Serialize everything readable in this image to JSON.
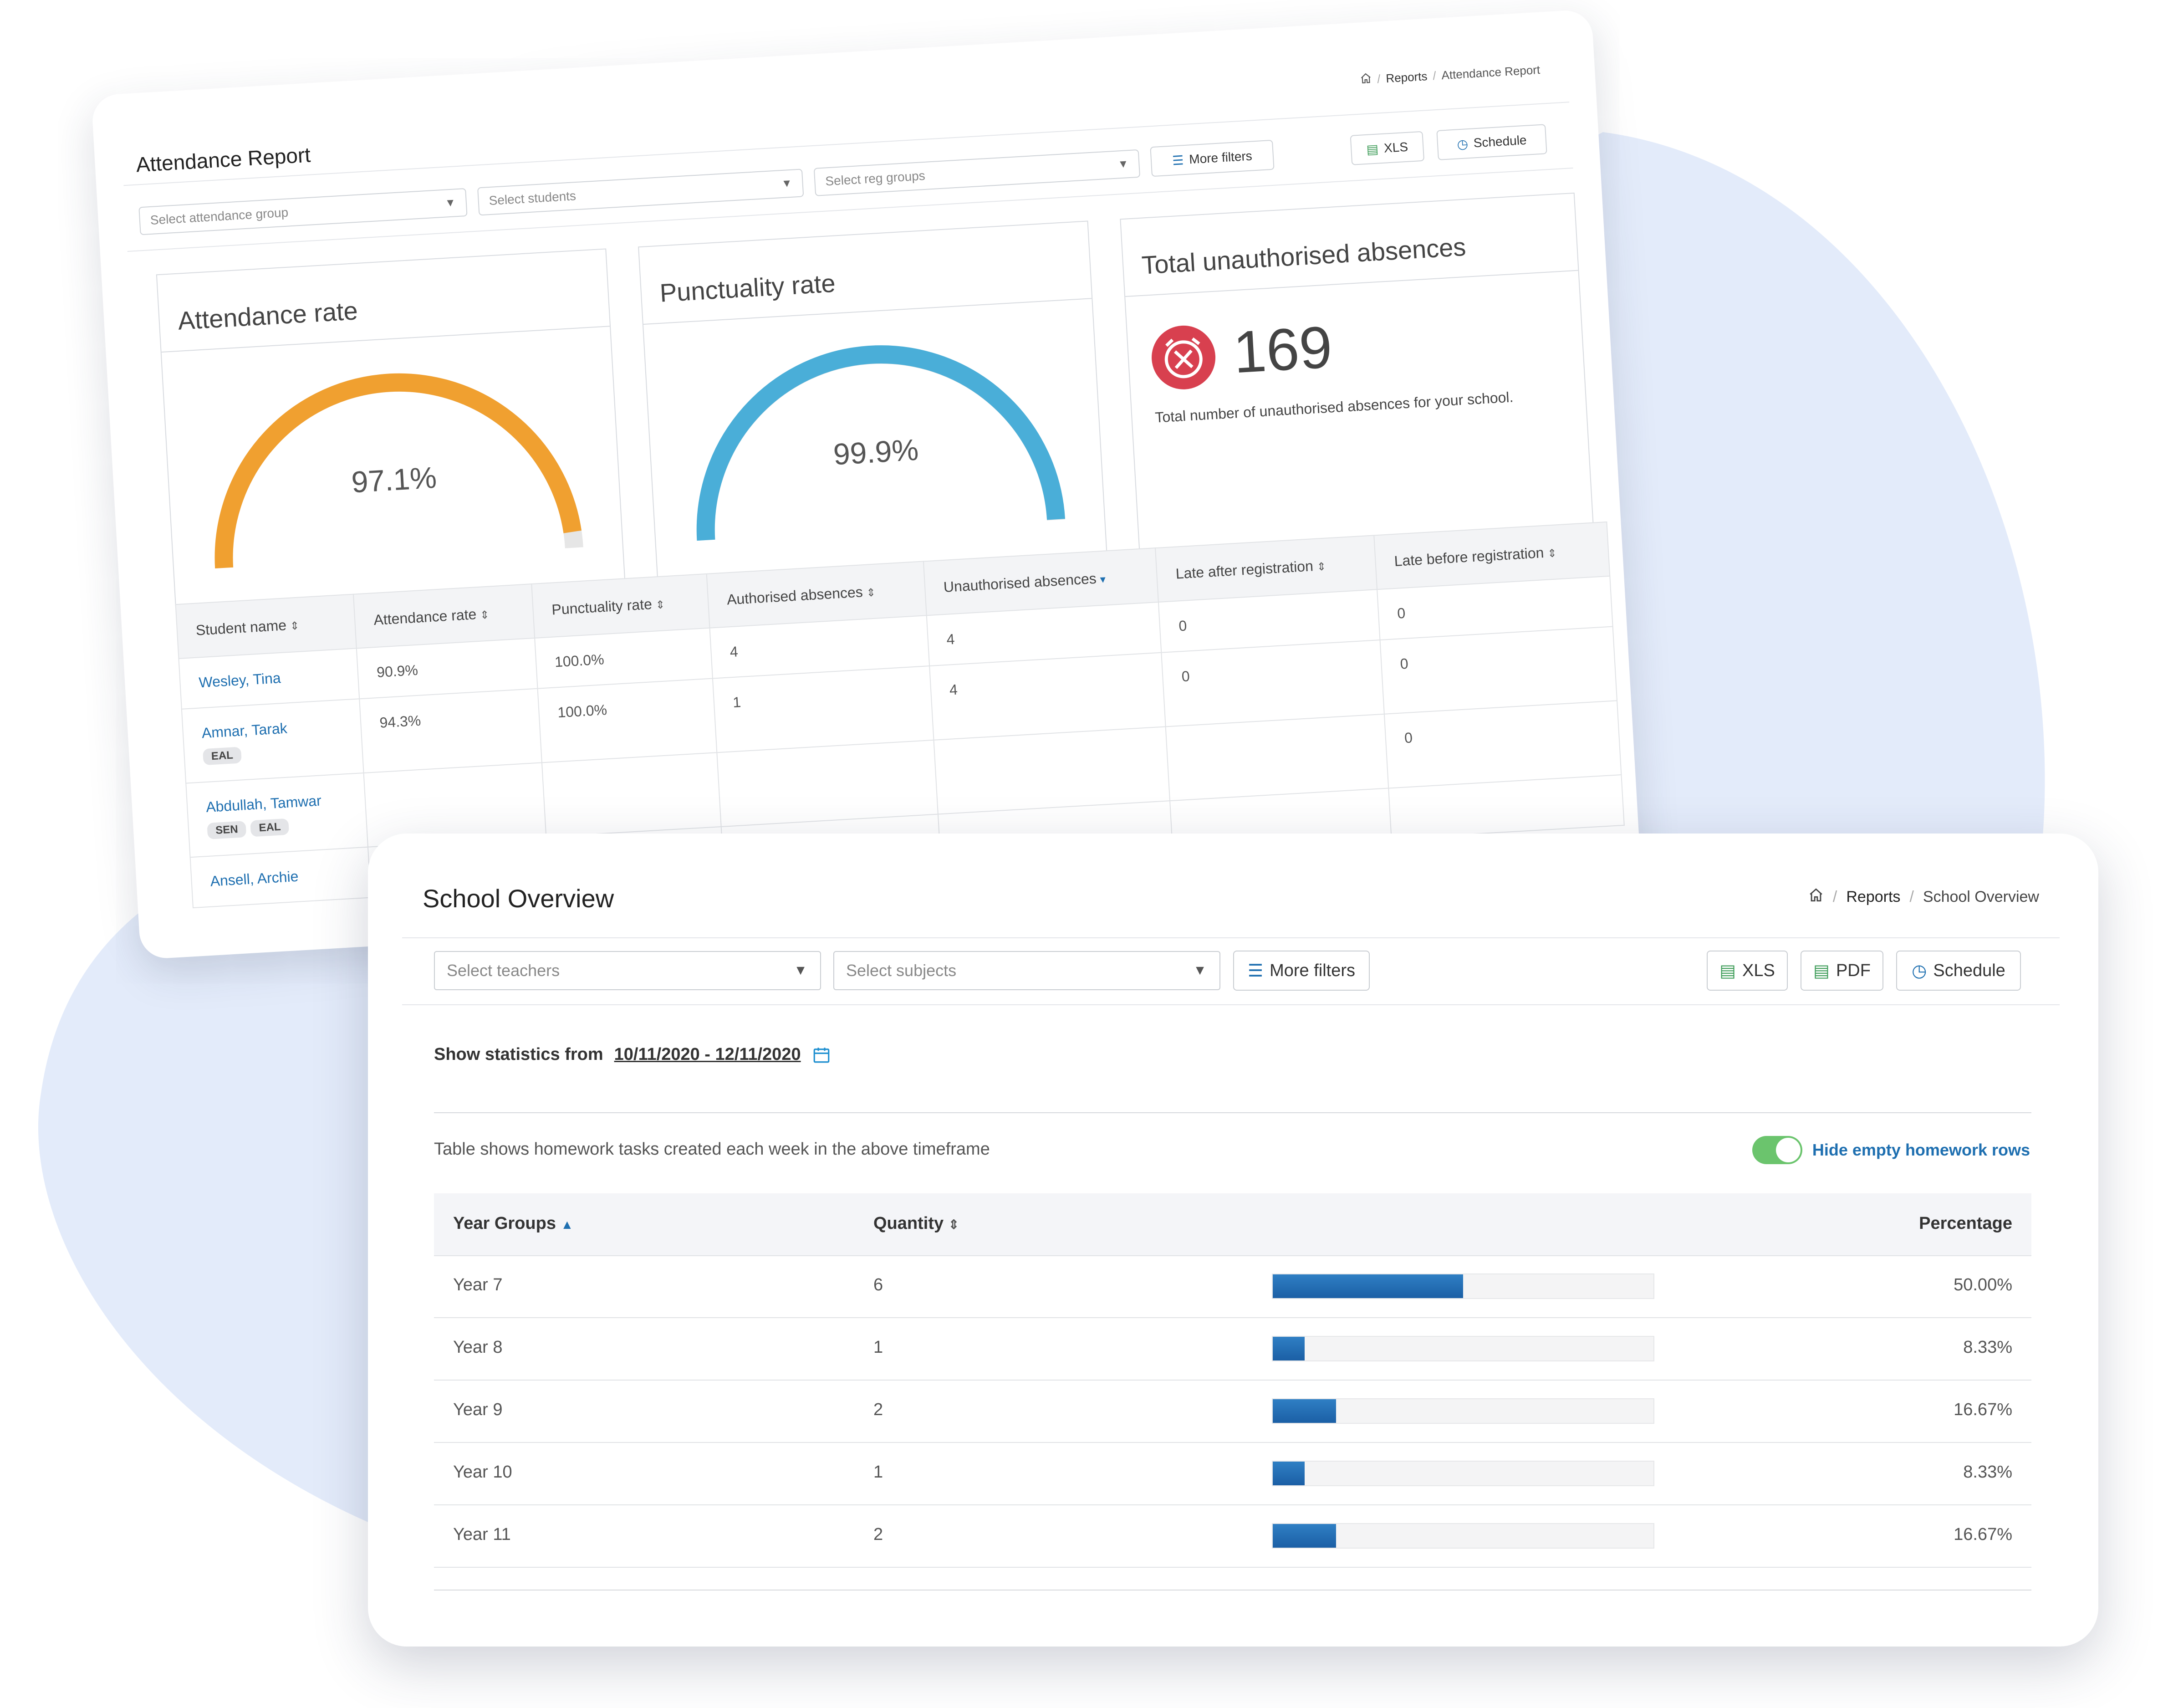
{
  "colors": {
    "accent_blue": "#1e6fb0",
    "gauge_orange": "#f0a030",
    "gauge_blue": "#4aaed8",
    "alarm_red": "#d8404f",
    "toggle_green": "#6bc46d",
    "blob": "#e3ebfa"
  },
  "attendance": {
    "title": "Attendance Report",
    "breadcrumb": {
      "home_icon": "home-icon",
      "reports": "Reports",
      "current": "Attendance Report"
    },
    "filters": {
      "group": "Select attendance group",
      "students": "Select students",
      "reg": "Select reg groups"
    },
    "buttons": {
      "more_filters": "More filters",
      "xls": "XLS",
      "schedule": "Schedule"
    },
    "cards": {
      "attendance_rate": {
        "title": "Attendance rate",
        "value": "97.1%",
        "percent": 97.1
      },
      "punctuality_rate": {
        "title": "Punctuality rate",
        "value": "99.9%",
        "percent": 99.9
      },
      "unauthorised": {
        "title": "Total unauthorised absences",
        "value": "169",
        "caption": "Total number of unauthorised absences for your school."
      }
    },
    "table": {
      "headers": [
        "Student name",
        "Attendance rate",
        "Punctuality rate",
        "Authorised absences",
        "Unauthorised absences",
        "Late after registration",
        "Late before registration"
      ],
      "rows": [
        {
          "name": "Wesley, Tina",
          "tags": [],
          "cells": [
            "90.9%",
            "100.0%",
            "4",
            "4",
            "0",
            "0"
          ]
        },
        {
          "name": "Amnar, Tarak",
          "tags": [
            "EAL"
          ],
          "cells": [
            "94.3%",
            "100.0%",
            "1",
            "4",
            "0",
            "0"
          ]
        },
        {
          "name": "Abdullah, Tamwar",
          "tags": [
            "SEN",
            "EAL"
          ],
          "cells": [
            "",
            "",
            "",
            "",
            "",
            "0"
          ]
        },
        {
          "name": "Ansell, Archie",
          "tags": [],
          "cells": [
            "",
            "",
            "",
            "",
            "",
            ""
          ]
        }
      ]
    }
  },
  "overview": {
    "title": "School Overview",
    "breadcrumb": {
      "home_icon": "home-icon",
      "reports": "Reports",
      "current": "School Overview"
    },
    "filters": {
      "teachers": "Select teachers",
      "subjects": "Select subjects"
    },
    "buttons": {
      "more_filters": "More filters",
      "xls": "XLS",
      "pdf": "PDF",
      "schedule": "Schedule"
    },
    "stats_label": "Show statistics from",
    "date_range": "10/11/2020 - 12/11/2020",
    "description": "Table shows homework tasks created each week in the above timeframe",
    "toggle_label": "Hide empty homework rows",
    "toggle_on": true,
    "table": {
      "headers": {
        "year": "Year Groups",
        "quantity": "Quantity",
        "percentage": "Percentage"
      },
      "rows": [
        {
          "year": "Year 7",
          "quantity": "6",
          "percentage": "50.00%",
          "fraction": 0.5
        },
        {
          "year": "Year 8",
          "quantity": "1",
          "percentage": "8.33%",
          "fraction": 0.0833
        },
        {
          "year": "Year 9",
          "quantity": "2",
          "percentage": "16.67%",
          "fraction": 0.1667
        },
        {
          "year": "Year 10",
          "quantity": "1",
          "percentage": "8.33%",
          "fraction": 0.0833
        },
        {
          "year": "Year 11",
          "quantity": "2",
          "percentage": "16.67%",
          "fraction": 0.1667
        }
      ]
    }
  }
}
